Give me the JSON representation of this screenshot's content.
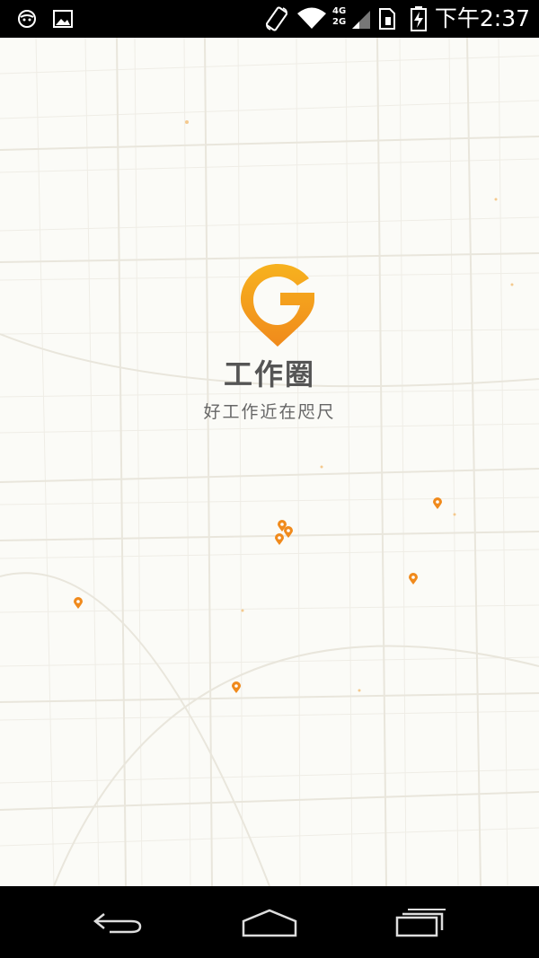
{
  "status_bar": {
    "clock": "下午2:37",
    "network_label_top": "4G",
    "network_label_bottom": "2G",
    "icons": [
      "robot-notification-icon",
      "image-notification-icon",
      "rotate-icon",
      "wifi-icon",
      "signal-icon",
      "sim-icon",
      "battery-charging-icon"
    ]
  },
  "splash": {
    "app_name": "工作圈",
    "slogan": "好工作近在咫尺",
    "logo_icon": "location-pin-g-logo-icon",
    "pin_icon": "map-marker-icon"
  },
  "nav_bar": {
    "icons": [
      "back-icon",
      "home-icon",
      "recent-apps-icon"
    ]
  },
  "colors": {
    "accent_orange": "#f5a623",
    "accent_orange_dark": "#f08a1c",
    "map_background": "#fbfbf7",
    "map_road": "#e9e6dc",
    "map_road_minor": "#efede6",
    "text_dark": "#555555"
  }
}
